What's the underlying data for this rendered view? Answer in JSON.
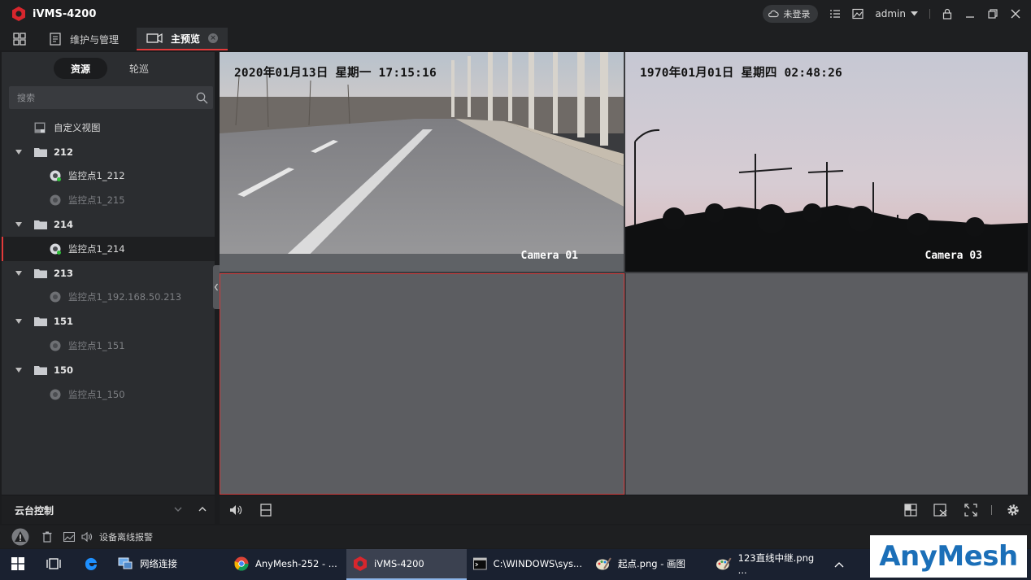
{
  "app": {
    "title": "iVMS-4200"
  },
  "titlebar": {
    "login_status": "未登录",
    "user": "admin"
  },
  "tabs": [
    {
      "label": "维护与管理"
    },
    {
      "label": "主预览"
    }
  ],
  "sidebar": {
    "segments": [
      "资源",
      "轮巡"
    ],
    "search_placeholder": "搜索",
    "custom_view": "自定义视图",
    "groups": [
      {
        "name": "212",
        "cameras": [
          {
            "name": "监控点1_212",
            "online": true
          },
          {
            "name": "监控点1_215",
            "online": false
          }
        ]
      },
      {
        "name": "214",
        "cameras": [
          {
            "name": "监控点1_214",
            "online": true,
            "selected": true
          }
        ]
      },
      {
        "name": "213",
        "cameras": [
          {
            "name": "监控点1_192.168.50.213",
            "online": false
          }
        ]
      },
      {
        "name": "151",
        "cameras": [
          {
            "name": "监控点1_151",
            "online": false
          }
        ]
      },
      {
        "name": "150",
        "cameras": [
          {
            "name": "监控点1_150",
            "online": false
          }
        ]
      }
    ],
    "ptz_label": "云台控制"
  },
  "video": {
    "panes": [
      {
        "timestamp": "2020年01月13日  星期一  17:15:16",
        "camera": "Camera 01"
      },
      {
        "timestamp": "1970年01月01日  星期四  02:48:26",
        "camera": "Camera 03"
      }
    ]
  },
  "status": {
    "alarm_label": "设备离线报警"
  },
  "taskbar": {
    "items": [
      {
        "label": "网络连接"
      },
      {
        "label": "AnyMesh-252 - ..."
      },
      {
        "label": "iVMS-4200"
      },
      {
        "label": "C:\\WINDOWS\\sys..."
      },
      {
        "label": "起点.png - 画图"
      },
      {
        "label": "123直线中继.png ..."
      }
    ]
  },
  "watermark": {
    "text": "AnyMesh"
  },
  "colors": {
    "accent": "#e23a3a",
    "panel": "#2b2d30",
    "bar": "#1e1f21",
    "empty_pane": "#5c5d61"
  }
}
